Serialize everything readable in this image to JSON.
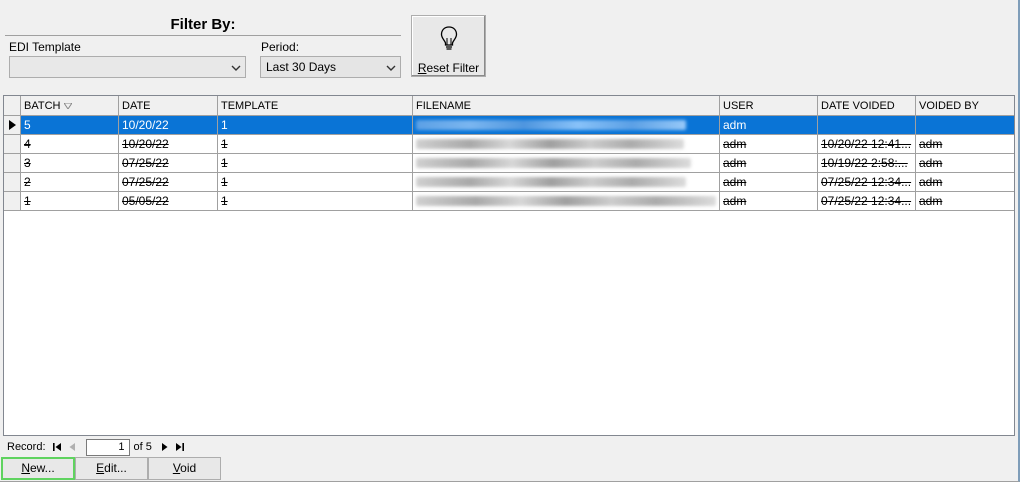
{
  "filter": {
    "title": "Filter By:",
    "edi_template_label": "EDI Template",
    "edi_template_value": "",
    "period_label": "Period:",
    "period_value": "Last 30 Days",
    "reset_prefix": "R",
    "reset_suffix": "eset Filter"
  },
  "grid": {
    "columns": [
      "BATCH",
      "DATE",
      "TEMPLATE",
      "FILENAME",
      "USER",
      "DATE VOIDED",
      "VOIDED BY"
    ],
    "rows": [
      {
        "batch": "5",
        "date": "10/20/22",
        "template": "1",
        "user": "adm",
        "date_voided": "",
        "voided_by": ""
      },
      {
        "batch": "4",
        "date": "10/20/22",
        "template": "1",
        "user": "adm",
        "date_voided": "10/20/22 12:41...",
        "voided_by": "adm"
      },
      {
        "batch": "3",
        "date": "07/25/22",
        "template": "1",
        "user": "adm",
        "date_voided": "10/19/22 2:58:...",
        "voided_by": "adm"
      },
      {
        "batch": "2",
        "date": "07/25/22",
        "template": "1",
        "user": "adm",
        "date_voided": "07/25/22 12:34...",
        "voided_by": "adm"
      },
      {
        "batch": "1",
        "date": "05/05/22",
        "template": "1",
        "user": "adm",
        "date_voided": "07/25/22 12:34...",
        "voided_by": "adm"
      }
    ]
  },
  "navigator": {
    "record_label": "Record:",
    "current": "1",
    "of_text": "of 5"
  },
  "buttons": {
    "new_prefix": "N",
    "new_suffix": "ew...",
    "edit_prefix": "E",
    "edit_suffix": "dit...",
    "void_prefix": "V",
    "void_suffix": "oid"
  },
  "colors": {
    "selection": "#0a74d6",
    "focus_outline": "#5fd35f"
  }
}
